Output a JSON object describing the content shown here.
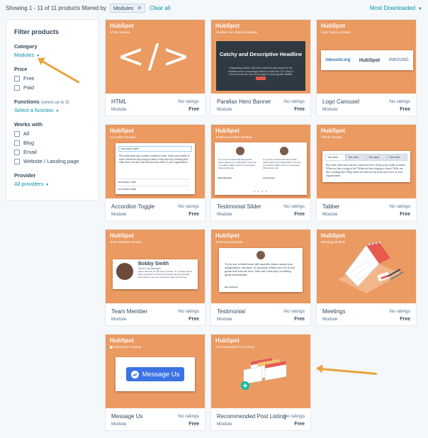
{
  "topbar": {
    "showing": "Showing 1 - 11 of 11 products filtered by",
    "chip_label": "Modules",
    "clear": "Clear all",
    "sort": "Most Downloaded"
  },
  "sidebar": {
    "title": "Filter products",
    "category": {
      "label": "Category",
      "value": "Modules"
    },
    "price": {
      "label": "Price",
      "options": [
        "Free",
        "Paid"
      ]
    },
    "functions": {
      "label": "Functions",
      "note": "(select up to 3)",
      "value": "Select a function"
    },
    "works_with": {
      "label": "Works with",
      "options": [
        "All",
        "Blog",
        "Email",
        "Website / Landing page"
      ]
    },
    "provider": {
      "label": "Provider",
      "value": "All providers"
    }
  },
  "brand": "HubSpot",
  "thumbs": {
    "html_code": "</>",
    "hero_title": "Catchy and Descriptive Headline",
    "hero_text": "Supporting content. Use this content to add context to the headline and to encourage visitors to click the CTA. Keep it short and use the rest of the page to cover greater details.",
    "logos": [
      "inbound.org",
      "HubSpot",
      "INBOUND"
    ],
    "accordion_head": "Accordion Label",
    "accordion_text": "Put some clear and concise content in here. Keep your reader in mind. What are they trying to learn? Why are they reading this? Help them out with use the time and voice of your organization.",
    "accordion_rows": [
      "Accordion Label",
      "Accordion Label"
    ],
    "slider_text": "Try to use a testimonial with specific claims about your organization, services, or products. Make sure it's a real quote that sounds real.",
    "slider_authors": [
      "Brad Boudon",
      "Lisa Gomez"
    ],
    "tab_labels": [
      "Tab Label",
      "Tab Label",
      "Tab Label",
      "Tab Label"
    ],
    "tab_text": "Put some clear and concise content in here. Keep your reader in mind. What are they trying to do? What are they hoping to learn? Why are they reading this? Help them out and use the time and voice of your organization.",
    "member_name": "Bobby Smith",
    "member_role": "Senior Org Wrangler",
    "member_bio": "Add a short bio for this team member. Try to keep each of these consistent in scope and format. Most importantly, remember to use your company's voice for this copy.",
    "testimonial_text": "Try to use a testimonial with specific claims about your organization, services, or products. Make sure it's a real quote that sounds real. Here are a few tips on writing great testimonials.",
    "testimonial_author": "Eric Johnson",
    "messenger_button": "Message Us"
  },
  "cards": [
    {
      "name": "HTML",
      "type": "Module",
      "rating": "No ratings",
      "price": "Free",
      "label": "HTML Module"
    },
    {
      "name": "Parallax Hero Banner",
      "type": "Module",
      "rating": "No ratings",
      "price": "Free",
      "label": "Parallax Hero Banner Module"
    },
    {
      "name": "Logo Carousel",
      "type": "Module",
      "rating": "No ratings",
      "price": "Free",
      "label": "Logo Gallery Module"
    },
    {
      "name": "Accordion Toggle",
      "type": "Module",
      "rating": "No ratings",
      "price": "Free",
      "label": "Accordion Module"
    },
    {
      "name": "Testimonial Slider",
      "type": "Module",
      "rating": "No ratings",
      "price": "Free",
      "label": "Testimonial Slider Module"
    },
    {
      "name": "Tabber",
      "type": "Module",
      "rating": "No ratings",
      "price": "Free",
      "label": "Tabber Module"
    },
    {
      "name": "Team Member",
      "type": "Module",
      "rating": "No ratings",
      "price": "Free",
      "label": "Team Member Module"
    },
    {
      "name": "Testimonial",
      "type": "Module",
      "rating": "No ratings",
      "price": "Free",
      "label": "Testimonial Module"
    },
    {
      "name": "Meetings",
      "type": "Module",
      "rating": "No ratings",
      "price": "Free",
      "label": "Meetings Module"
    },
    {
      "name": "Message Us",
      "type": "Module",
      "rating": "No ratings",
      "price": "Free",
      "label": "Messenger Module"
    },
    {
      "name": "Recommended Post Listing",
      "type": "Module",
      "rating": "No ratings",
      "price": "Free",
      "label": "Recommended Post Listing"
    }
  ],
  "colors": {
    "card_bg": "#eb9a62",
    "accent": "#0091ae",
    "arrow": "#e8a23a",
    "messenger": "#3b73e5"
  }
}
